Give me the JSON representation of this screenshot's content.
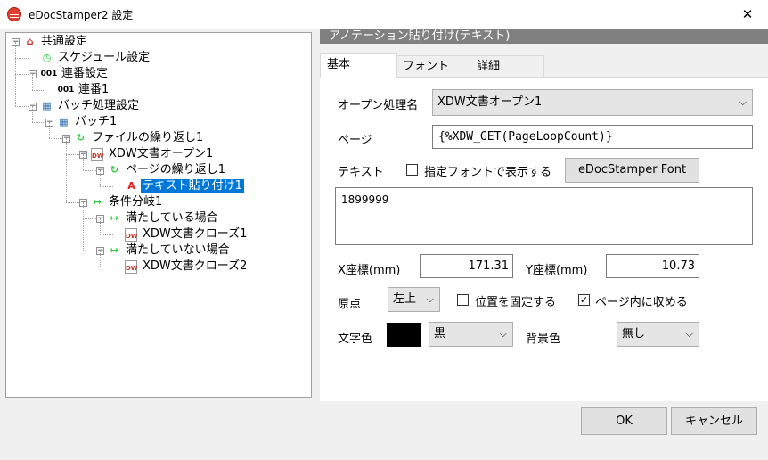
{
  "window": {
    "title": "eDocStamper2 設定",
    "close_glyph": "✕"
  },
  "tree": [
    {
      "label": "共通設定",
      "icon": "house-icon",
      "glyph": "⌂",
      "color": "#c0392b",
      "toggle": "−"
    },
    {
      "label": "スケジュール設定",
      "icon": "clock-icon",
      "glyph": "◷",
      "color": "#2ecc40"
    },
    {
      "label": "連番設定",
      "icon": "number-icon",
      "glyph": "001",
      "color": "#000000",
      "toggle": "−"
    },
    {
      "label": "連番1",
      "icon": "number-icon",
      "glyph": "001",
      "color": "#000000"
    },
    {
      "label": "バッチ処理設定",
      "icon": "batch-icon",
      "glyph": "▦",
      "color": "#2b6cb0",
      "toggle": "−"
    },
    {
      "label": "バッチ1",
      "icon": "batch-icon",
      "glyph": "▦",
      "color": "#2b6cb0",
      "toggle": "−"
    },
    {
      "label": "ファイルの繰り返し1",
      "icon": "loop-icon",
      "glyph": "↻",
      "color": "#2ecc40",
      "toggle": "−"
    },
    {
      "label": "XDW文書オープン1",
      "icon": "document-icon",
      "glyph": "DW",
      "color": "#c0392b",
      "toggle": "−"
    },
    {
      "label": "ページの繰り返し1",
      "icon": "loop-icon",
      "glyph": "↻",
      "color": "#2ecc40",
      "toggle": "−"
    },
    {
      "label": "テキスト貼り付け1",
      "icon": "text-annotation-icon",
      "glyph": "A",
      "color": "#e02020",
      "selected": true
    },
    {
      "label": "条件分岐1",
      "icon": "branch-icon",
      "glyph": "↦",
      "color": "#2ecc40",
      "toggle": "−"
    },
    {
      "label": "満たしている場合",
      "icon": "branch-icon",
      "glyph": "↦",
      "color": "#2ecc40",
      "toggle": "−"
    },
    {
      "label": "XDW文書クローズ1",
      "icon": "document-icon",
      "glyph": "DW",
      "color": "#c0392b"
    },
    {
      "label": "満たしていない場合",
      "icon": "branch-icon",
      "glyph": "↦",
      "color": "#2ecc40",
      "toggle": "−"
    },
    {
      "label": "XDW文書クローズ2",
      "icon": "document-icon",
      "glyph": "DW",
      "color": "#c0392b"
    }
  ],
  "pane": {
    "header": "アノテーション貼り付け(テキスト)",
    "tabs": [
      "基本",
      "フォント",
      "詳細"
    ],
    "active_tab": 0
  },
  "form": {
    "open_label": "オープン処理名",
    "open_value": "XDW文書オープン1",
    "page_label": "ページ",
    "page_value": "{%XDW_GET(PageLoopCount)}",
    "text_label": "テキスト",
    "font_checkbox_label": "指定フォントで表示する",
    "font_checkbox_checked": false,
    "font_button": "eDocStamper Font",
    "text_value": "1899999",
    "x_label": "X座標(mm)",
    "x_value": "171.31",
    "y_label": "Y座標(mm)",
    "y_value": "10.73",
    "origin_label": "原点",
    "origin_value": "左上",
    "fix_position_label": "位置を固定する",
    "fix_position_checked": false,
    "fit_page_label": "ページ内に収める",
    "fit_page_checked": true,
    "text_color_label": "文字色",
    "text_color_swatch": "#000000",
    "text_color_value": "黒",
    "bg_color_label": "背景色",
    "bg_color_value": "無し",
    "check_glyph": "✓",
    "dropdown_glyph": "⌵"
  },
  "footer": {
    "ok": "OK",
    "cancel": "キャンセル"
  }
}
